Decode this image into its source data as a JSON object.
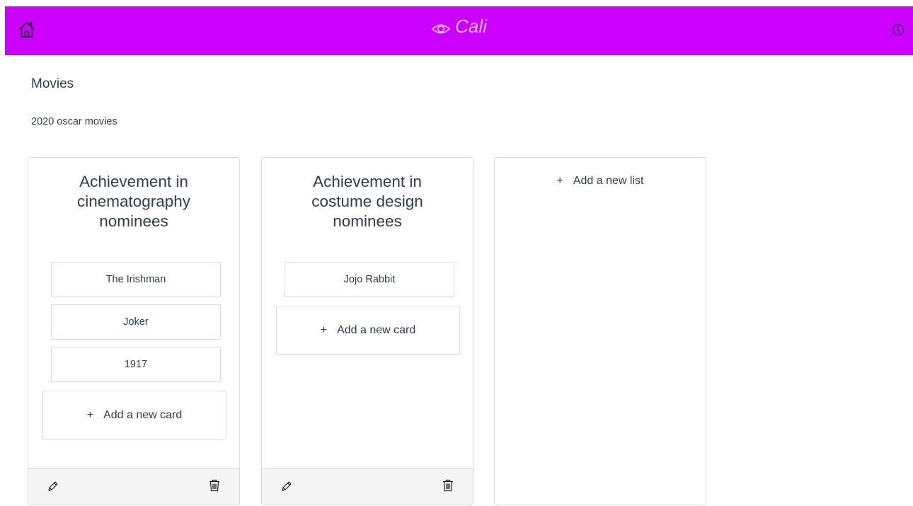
{
  "app": {
    "brand": "Cali",
    "colors": {
      "navbar": "#cc00ff",
      "brand_text": "#f3b8ff",
      "text": "#2c3e50",
      "border": "#dcdcdc",
      "footer": "#f5f5f5"
    }
  },
  "navbar": {
    "home_icon": "home-icon",
    "brand_icon": "eye-icon",
    "info_icon": "info-icon"
  },
  "board": {
    "title": "Movies",
    "description": "2020 oscar movies"
  },
  "lists": [
    {
      "title": "Achievement in cinematography nominees",
      "cards": [
        "The Irishman",
        "Joker",
        "1917"
      ],
      "add_card_label": "Add a new card"
    },
    {
      "title": "Achievement in costume design nominees",
      "cards": [
        "Jojo Rabbit"
      ],
      "add_card_label": "Add a new card"
    }
  ],
  "add_list": {
    "plus": "+",
    "label": "Add a new list"
  },
  "add_card_plus": "+"
}
